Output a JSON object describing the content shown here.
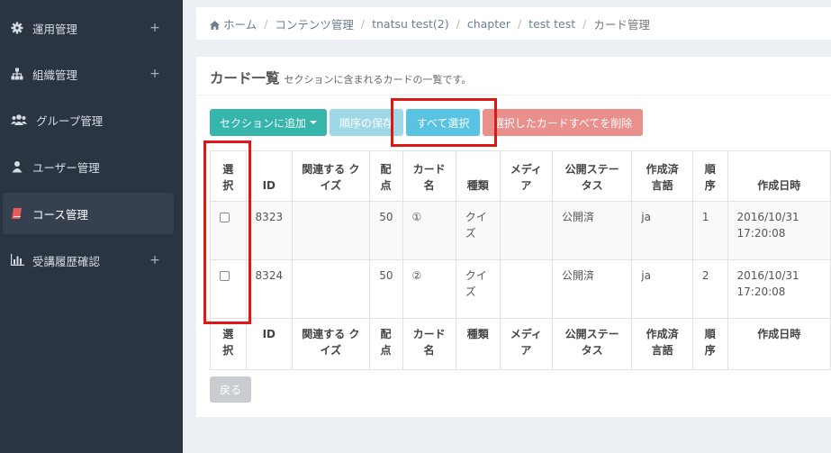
{
  "sidebar": {
    "items": [
      {
        "label": "運用管理",
        "icon": "gear-icon",
        "expand": "+"
      },
      {
        "label": "組織管理",
        "icon": "sitemap-icon",
        "expand": "+"
      },
      {
        "label": "グループ管理",
        "icon": "users-icon",
        "expand": ""
      },
      {
        "label": "ユーザー管理",
        "icon": "user-icon",
        "expand": ""
      },
      {
        "label": "コース管理",
        "icon": "book-icon",
        "expand": ""
      },
      {
        "label": "受講履歴確認",
        "icon": "bar-chart-icon",
        "expand": "+"
      }
    ],
    "active_item": "コース管理"
  },
  "breadcrumb": {
    "home_icon": "home-icon",
    "items": [
      "ホーム",
      "コンテンツ管理",
      "tnatsu test(2)",
      "chapter",
      "test test",
      "カード管理"
    ]
  },
  "panel": {
    "title": "カード一覧",
    "subtitle": "セクションに含まれるカードの一覧です。"
  },
  "toolbar": {
    "add_label": "セクションに追加",
    "order_label": "順序の保存",
    "select_all_label": "すべて選択",
    "delete_label": "選択したカードすべてを削除"
  },
  "table": {
    "headers": [
      "選択",
      "ID",
      "関連する クイズ",
      "配点",
      "カード名",
      "種類",
      "メディア",
      "公開ステータス",
      "作成済言語",
      "順序",
      "作成日時"
    ],
    "rows": [
      {
        "id": "8323",
        "quiz": "",
        "points": "50",
        "name": "①",
        "type": "クイズ",
        "media": "",
        "status": "公開済",
        "lang": "ja",
        "order": "1",
        "created": "2016/10/31 17:20:08"
      },
      {
        "id": "8324",
        "quiz": "",
        "points": "50",
        "name": "②",
        "type": "クイズ",
        "media": "",
        "status": "公開済",
        "lang": "ja",
        "order": "2",
        "created": "2016/10/31 17:20:08"
      }
    ]
  },
  "footer": {
    "back_label": "戻る"
  },
  "colors": {
    "sidebar_bg": "#2a3542",
    "add_button": "#35b5ab",
    "order_button": "#9fd8e6",
    "select_all_button": "#58c3e3",
    "delete_button": "#e98f8c",
    "highlight": "#e01717"
  }
}
